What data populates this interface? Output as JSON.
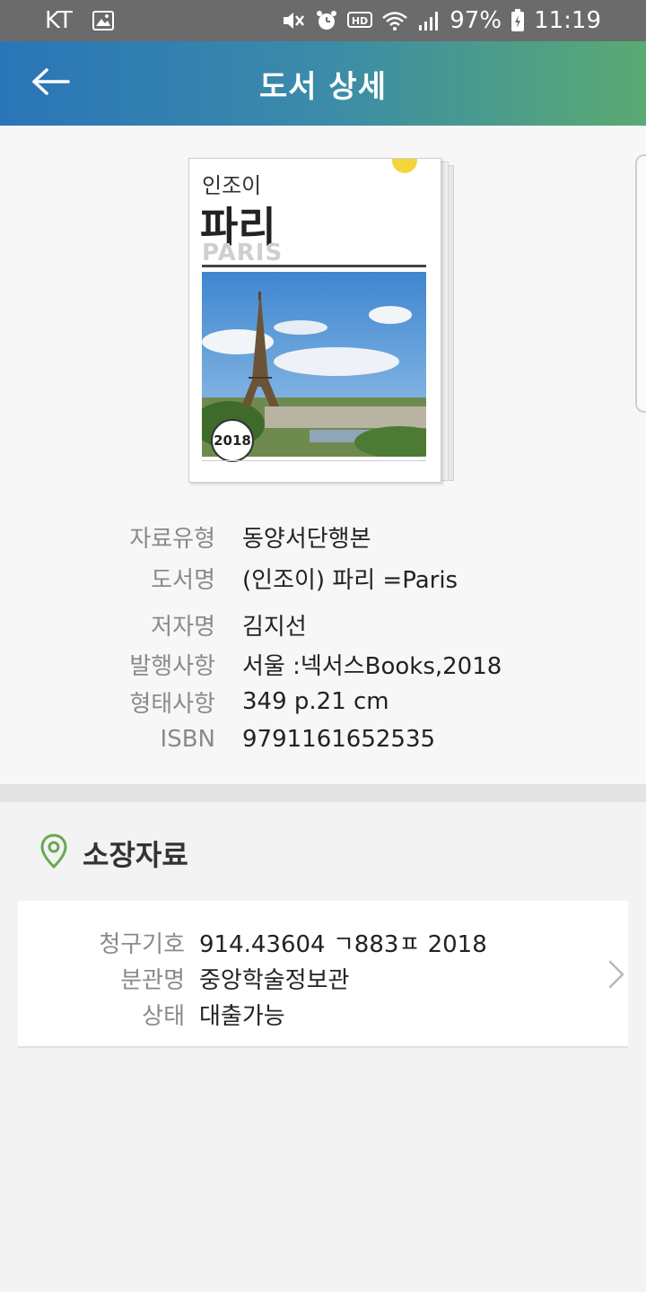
{
  "status_bar": {
    "carrier": "KT",
    "battery": "97%",
    "time": "11:19",
    "icons": [
      "image-icon",
      "mute-icon",
      "alarm-icon",
      "hd-icon",
      "wifi-icon",
      "signal-icon",
      "battery-icon"
    ]
  },
  "app_bar": {
    "title": "도서 상세",
    "back_icon": "back-arrow-icon"
  },
  "book": {
    "cover": {
      "small_title": "인조이",
      "main_title": "파리",
      "english_title": "PARIS",
      "year_badge": "2018"
    },
    "fields": [
      {
        "label": "자료유형",
        "value": "동양서단행본"
      },
      {
        "label": "도서명",
        "value": "(인조이) 파리 =Paris"
      },
      {
        "label": "저자명",
        "value": "김지선"
      },
      {
        "label": "발행사항",
        "value": "서울 :넥서스Books,2018"
      },
      {
        "label": "형태사항",
        "value": "349 p.21 cm"
      },
      {
        "label": "ISBN",
        "value": "9791161652535"
      }
    ]
  },
  "holdings": {
    "title": "소장자료",
    "icon": "location-pin-icon",
    "accent_color": "#6aa84f",
    "items": [
      {
        "call_number_label": "청구기호",
        "call_number": "914.43604 ㄱ883ㅍ 2018",
        "branch_label": "분관명",
        "branch": "중앙학술정보관",
        "status_label": "상태",
        "status": "대출가능"
      }
    ]
  }
}
